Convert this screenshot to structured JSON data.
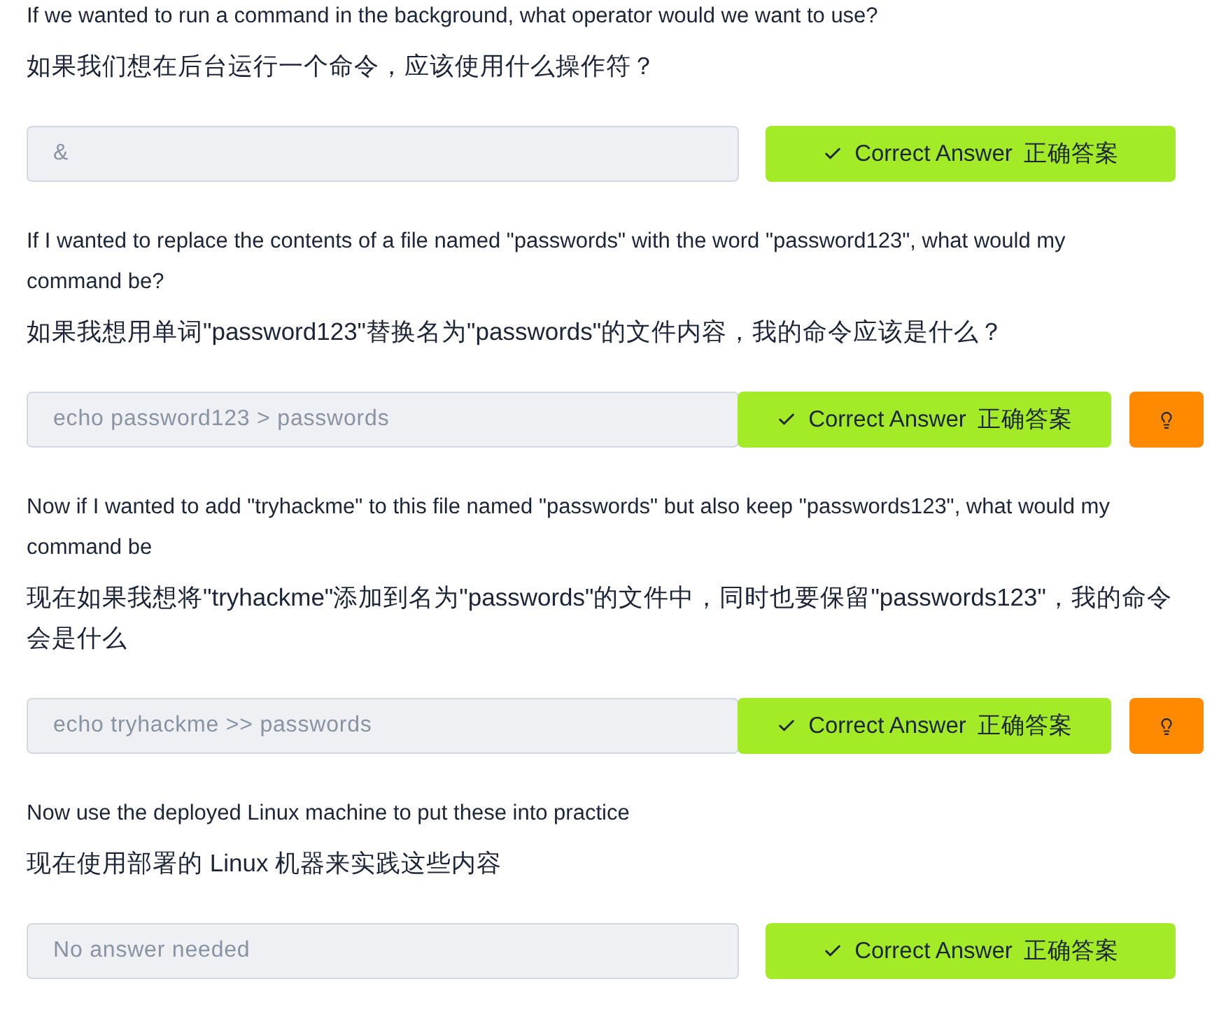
{
  "questions": [
    {
      "question": "If we wanted to run a command in the background, what operator would we want to use?",
      "question_zh": "如果我们想在后台运行一个命令，应该使用什么操作符？",
      "answer": {
        "value": "&",
        "disabled": true
      },
      "submit": {
        "label": "Correct Answer",
        "label_zh": "正确答案",
        "correct": true
      },
      "has_hint": false
    },
    {
      "question": "If I wanted to replace the contents of a file named \"passwords\" with the word \"password123\", what would my command be?",
      "question_zh": "如果我想用单词\"password123\"替换名为\"passwords\"的文件内容，我的命令应该是什么？",
      "answer": {
        "value": "echo password123 > passwords",
        "disabled": true
      },
      "submit": {
        "label": "Correct Answer",
        "label_zh": "正确答案",
        "correct": true
      },
      "has_hint": true
    },
    {
      "question": "Now if I wanted to add \"tryhackme\" to this file named \"passwords\" but also keep \"passwords123\", what would my command be",
      "question_zh": "现在如果我想将\"tryhackme\"添加到名为\"passwords\"的文件中，同时也要保留\"passwords123\"，我的命令会是什么",
      "answer": {
        "value": "echo tryhackme >> passwords",
        "disabled": true
      },
      "submit": {
        "label": "Correct Answer",
        "label_zh": "正确答案",
        "correct": true
      },
      "has_hint": true
    },
    {
      "question": "Now use the deployed Linux machine to put these into practice",
      "question_zh": "现在使用部署的 Linux 机器来实践这些内容",
      "answer": {
        "placeholder": "No answer needed",
        "disabled": true
      },
      "submit": {
        "label": "Correct Answer",
        "label_zh": "正确答案",
        "correct": true
      },
      "has_hint": false
    }
  ]
}
